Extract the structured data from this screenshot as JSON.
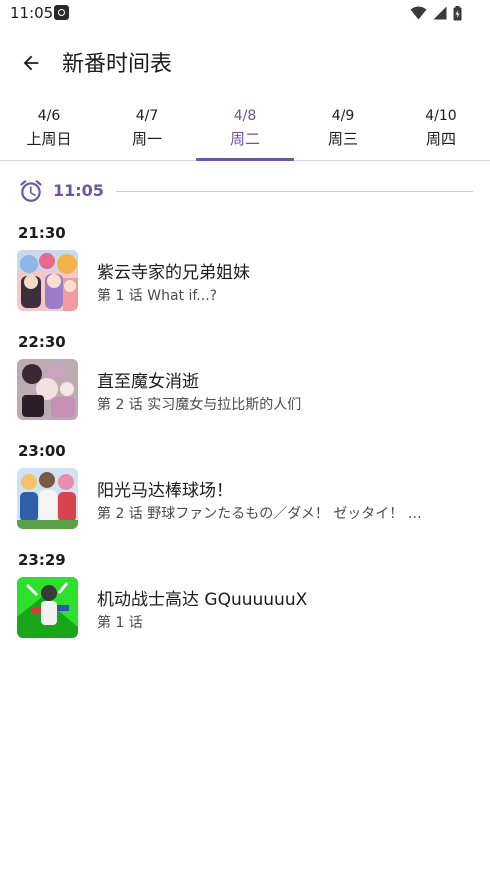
{
  "status_bar": {
    "time": "11:05"
  },
  "header": {
    "title": "新番时间表"
  },
  "tabs": [
    {
      "date": "4/6",
      "day": "上周日",
      "active": false
    },
    {
      "date": "4/7",
      "day": "周一",
      "active": false
    },
    {
      "date": "4/8",
      "day": "周二",
      "active": true
    },
    {
      "date": "4/9",
      "day": "周三",
      "active": false
    },
    {
      "date": "4/10",
      "day": "周四",
      "active": false
    }
  ],
  "now": {
    "time": "11:05"
  },
  "colors": {
    "accent": "#6e54a3",
    "divider": "#d8d8dc"
  },
  "schedule": [
    {
      "time": "21:30",
      "title": "紫云寺家的兄弟姐妹",
      "episode": "第 1 话  What if...?"
    },
    {
      "time": "22:30",
      "title": "直至魔女消逝",
      "episode": "第 2 话  实习魔女与拉比斯的人们"
    },
    {
      "time": "23:00",
      "title": "阳光马达棒球场！",
      "episode": "第 2 话  野球ファンたるもの／ダメ！ ゼッタイ！ …"
    },
    {
      "time": "23:29",
      "title": "机动战士高达 GQuuuuuuX",
      "episode": "第 1 话"
    }
  ]
}
